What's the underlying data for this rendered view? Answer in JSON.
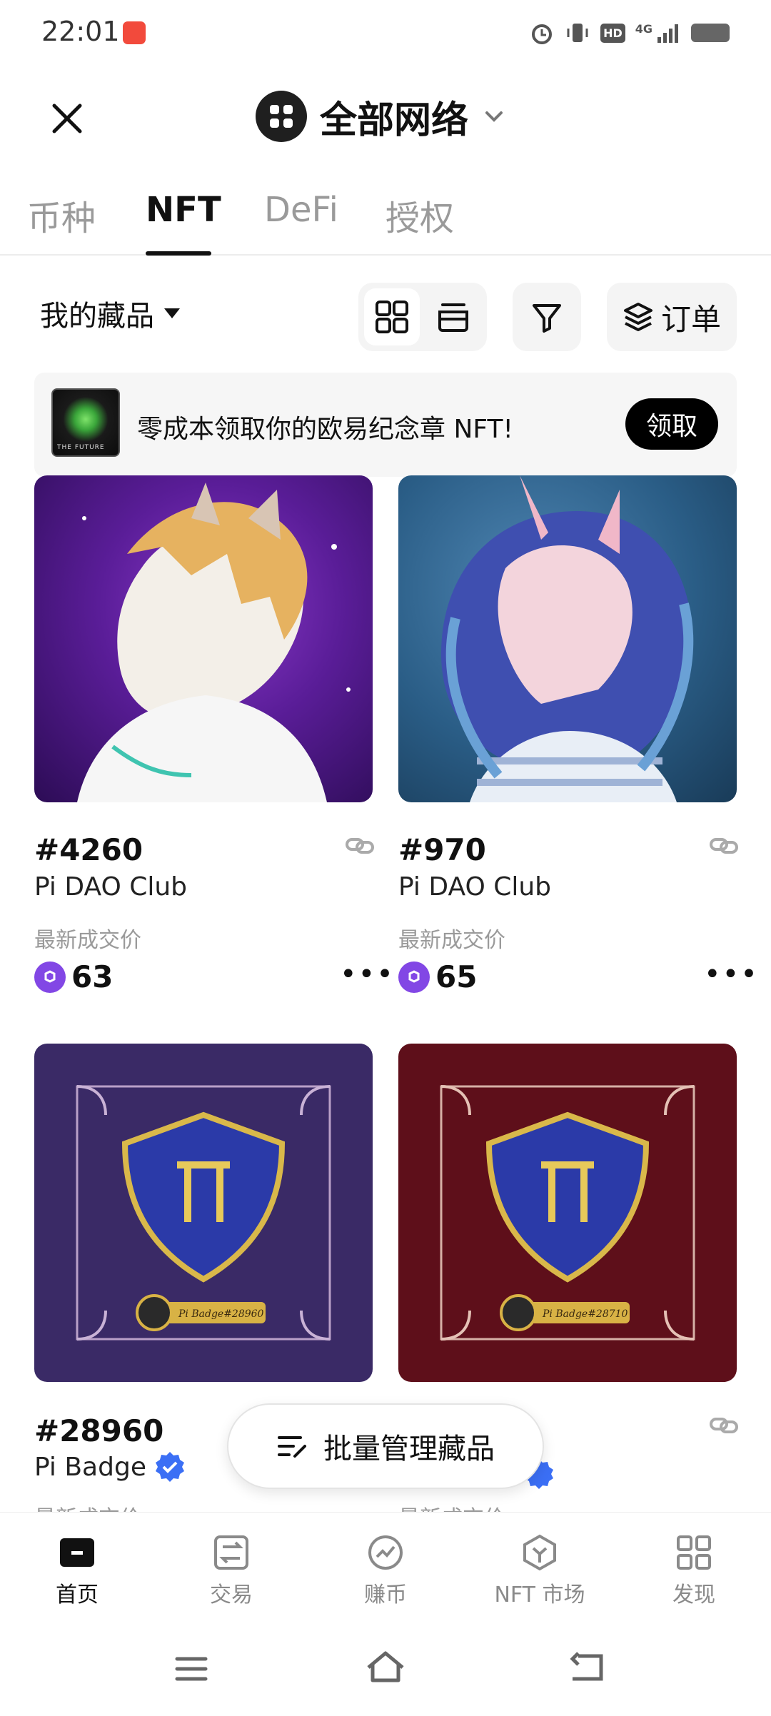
{
  "status_bar": {
    "time": "22:01",
    "signal": "4G",
    "hd": "HD"
  },
  "header": {
    "network_title": "全部网络"
  },
  "tabs": [
    {
      "label": "币种",
      "active": false
    },
    {
      "label": "NFT",
      "active": true
    },
    {
      "label": "DeFi",
      "active": false
    },
    {
      "label": "授权",
      "active": false
    }
  ],
  "toolbar": {
    "collection_filter": "我的藏品",
    "orders_label": "订单"
  },
  "banner": {
    "text": "零成本领取你的欧易纪念章 NFT!",
    "claim_label": "领取",
    "thumb_caption": "THE FUTURE"
  },
  "cards": [
    {
      "id": "#4260",
      "collection": "Pi DAO Club",
      "price_label": "最新成交价",
      "price": "63",
      "verified": false
    },
    {
      "id": "#970",
      "collection": "Pi DAO Club",
      "price_label": "最新成交价",
      "price": "65",
      "verified": false
    },
    {
      "id": "#28960",
      "collection": "Pi Badge",
      "price_label": "最新成交价",
      "price": "",
      "verified": true,
      "badge_text": "Pi Badge#28960"
    },
    {
      "id": "",
      "collection": "",
      "price_label": "最新成交价",
      "price": "",
      "verified": true,
      "badge_text": "Pi Badge#28710"
    }
  ],
  "batch_manage": {
    "label": "批量管理藏品"
  },
  "bottom_nav": [
    {
      "label": "首页",
      "icon": "home-icon",
      "active": true
    },
    {
      "label": "交易",
      "icon": "trade-icon",
      "active": false
    },
    {
      "label": "赚币",
      "icon": "earn-icon",
      "active": false
    },
    {
      "label": "NFT 市场",
      "icon": "nft-market-icon",
      "active": false
    },
    {
      "label": "发现",
      "icon": "discover-icon",
      "active": false
    }
  ],
  "colors": {
    "polygon": "#8247e5",
    "verified": "#3b6ff5",
    "card1_bg": "#4a1f7a",
    "card2_bg": "#2a5d86",
    "card3_bg": "#3a2a66",
    "card4_bg": "#5e0f1a"
  }
}
